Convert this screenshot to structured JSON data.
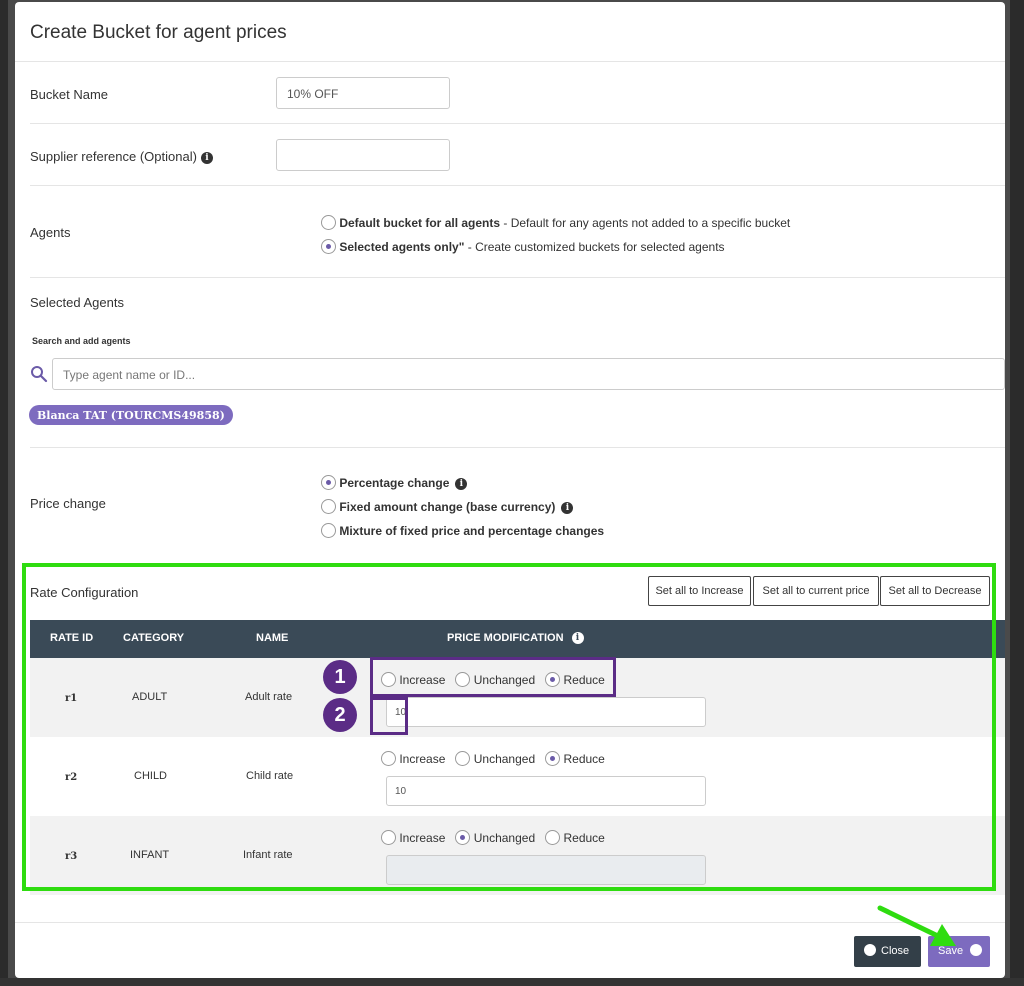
{
  "modal": {
    "title": "Create Bucket for agent prices"
  },
  "bucket_name": {
    "label": "Bucket Name",
    "value": "10% OFF"
  },
  "supplier_ref": {
    "label": "Supplier reference (Optional)",
    "value": ""
  },
  "agents": {
    "label": "Agents",
    "options": [
      {
        "title": "Default bucket for all agents",
        "desc": " - Default for any agents not added to a specific bucket",
        "checked": false
      },
      {
        "title": "Selected agents only\"",
        "desc": " - Create customized buckets for selected agents",
        "checked": true
      }
    ]
  },
  "selected_agents": {
    "label": "Selected Agents",
    "search_label": "Search and add agents",
    "search_placeholder": "Type agent name or ID...",
    "chip": "Blanca TAT (TOURCMS49858)"
  },
  "price_change": {
    "label": "Price change",
    "options": [
      {
        "title": "Percentage change",
        "checked": true,
        "info": true
      },
      {
        "title": "Fixed amount change (base currency)",
        "checked": false,
        "info": true
      },
      {
        "title": "Mixture of fixed price and percentage changes",
        "checked": false,
        "info": false
      }
    ]
  },
  "rate_config": {
    "label": "Rate Configuration",
    "buttons": {
      "increase": "Set all to Increase",
      "current": "Set all to current price",
      "decrease": "Set all to Decrease"
    },
    "headers": {
      "rate_id": "RATE ID",
      "category": "CATEGORY",
      "name": "NAME",
      "price_mod": "PRICE MODIFICATION"
    },
    "radio_labels": {
      "increase": "Increase",
      "unchanged": "Unchanged",
      "reduce": "Reduce"
    },
    "rows": [
      {
        "id": "r1",
        "category": "ADULT",
        "name": "Adult rate",
        "selected": "reduce",
        "value": "10"
      },
      {
        "id": "r2",
        "category": "CHILD",
        "name": "Child rate",
        "selected": "reduce",
        "value": "10"
      },
      {
        "id": "r3",
        "category": "INFANT",
        "name": "Infant rate",
        "selected": "unchanged",
        "value": ""
      }
    ]
  },
  "annotations": {
    "badge1": "1",
    "badge2": "2",
    "box_color": "#5b2c86",
    "highlight_color": "#2fdc10"
  },
  "footer": {
    "close_label": "Close",
    "save_label": "Save"
  },
  "colors": {
    "accent": "#7d6bbf",
    "header_bg": "#3a4a57",
    "close_bg": "#333f48"
  }
}
